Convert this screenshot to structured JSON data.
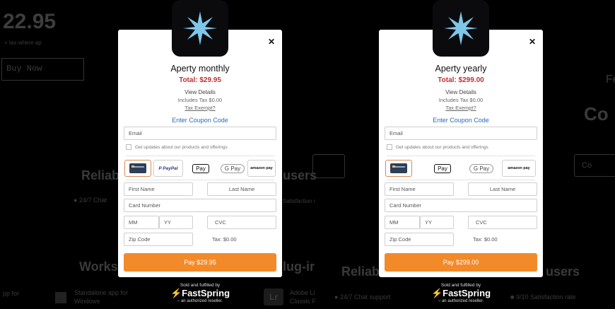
{
  "background": {
    "left": {
      "price": "22.95",
      "subtext": "+ tax where ap",
      "buy_label": "Buy Now",
      "heading_reliab": "Reliab",
      "heading_users": "users",
      "chat": "24/7 Chat",
      "satisfaction": "Satisfaction r",
      "heading_works": "Works",
      "heading_plugin": "lug-ir",
      "app_for": "pp for",
      "standalone_1": "Standalone app for",
      "standalone_2": "Windows",
      "adobe_1": "Adobe Li",
      "adobe_2": "Classic F"
    },
    "right": {
      "heading_reliab": "Reliab",
      "heading_users": "users",
      "chat": "24/7 Chat support",
      "satisfaction": "9/10 Satisfaction rate",
      "cor": "Co",
      "fe": "Fe",
      "co_button": "Co"
    }
  },
  "modals": [
    {
      "plan": "Aperty monthly",
      "total": "Total: $29.95",
      "view_details": "View Details",
      "includes_tax": "Includes Tax $0.00",
      "tax_exempt": "Tax Exempt?",
      "coupon": "Enter Coupon Code",
      "email_placeholder": "Email",
      "updates": "Get updates about our products and offerings",
      "payment_methods": [
        "Card",
        "PayPal",
        "Apple Pay",
        "Google Pay",
        "Amazon Pay"
      ],
      "first_name": "First Name",
      "last_name": "Last Name",
      "card_number": "Card Number",
      "mm": "MM",
      "yy": "YY",
      "cvc": "CVC",
      "zip": "Zip Code",
      "tax_line": "Tax: $0.00",
      "pay_label": "Pay $29.95"
    },
    {
      "plan": "Aperty yearly",
      "total": "Total: $299.00",
      "view_details": "View Details",
      "includes_tax": "Includes Tax $0.00",
      "tax_exempt": "Tax Exempt?",
      "coupon": "Enter Coupon Code",
      "email_placeholder": "Email",
      "updates": "Get updates about our products and offerings",
      "payment_methods": [
        "Card",
        "Apple Pay",
        "Google Pay",
        "Amazon Pay"
      ],
      "first_name": "First Name",
      "last_name": "Last Name",
      "card_number": "Card Number",
      "mm": "MM",
      "yy": "YY",
      "cvc": "CVC",
      "zip": "Zip Code",
      "tax_line": "Tax: $0.00",
      "pay_label": "Pay $299.00"
    }
  ],
  "footer": {
    "sold_by": "Sold and fulfilled by",
    "brand": "FastSpring",
    "reseller": "– an authorized reseller."
  },
  "colors": {
    "accent": "#f38a2a",
    "total": "#c0312b",
    "link": "#2a6bb5"
  }
}
